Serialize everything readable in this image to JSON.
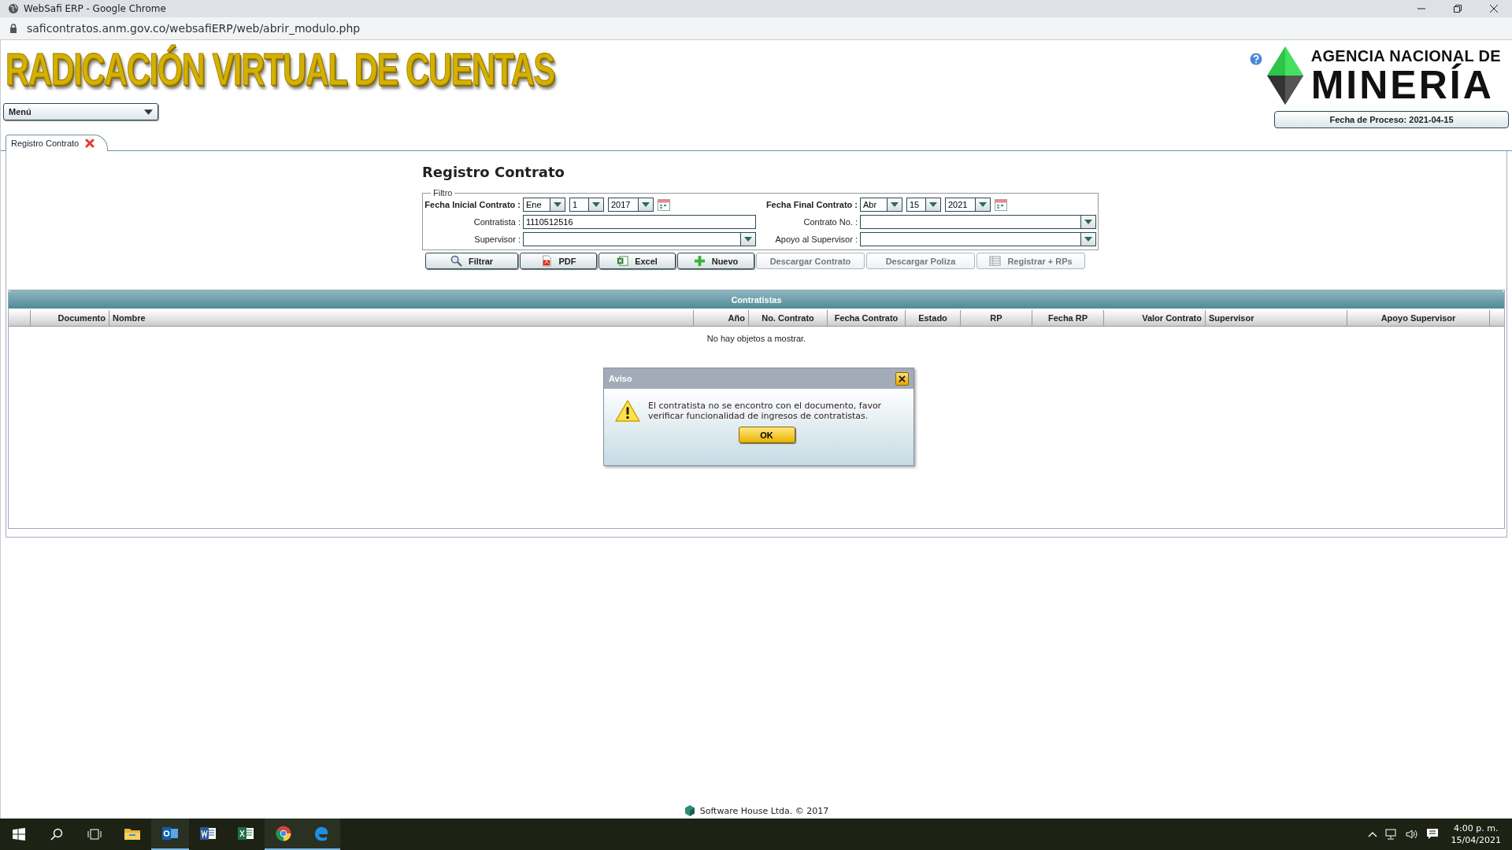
{
  "window": {
    "title": "WebSafi ERP - Google Chrome",
    "url": "saficontratos.anm.gov.co/websafiERP/web/abrir_modulo.php"
  },
  "banner": {
    "title": "RADICACIÓN VIRTUAL DE CUENTAS",
    "agency_line1": "AGENCIA NACIONAL DE",
    "agency_line2": "MINERÍA",
    "process_date": "Fecha de Proceso: 2021-04-15"
  },
  "menu": {
    "label": "Menú"
  },
  "tabs": [
    {
      "label": "Registro Contrato",
      "selected": true
    }
  ],
  "form": {
    "title": "Registro Contrato",
    "legend": "Filtro",
    "fecha_inicial": {
      "label": "Fecha Inicial Contrato :",
      "month": "Ene",
      "day": "1",
      "year": "2017"
    },
    "fecha_final": {
      "label": "Fecha Final Contrato :",
      "month": "Abr",
      "day": "15",
      "year": "2021"
    },
    "contratista": {
      "label": "Contratista :",
      "value": "1110512516"
    },
    "contrato_no": {
      "label": "Contrato No. :"
    },
    "supervisor": {
      "label": "Supervisor :"
    },
    "apoyo": {
      "label": "Apoyo al Supervisor :"
    },
    "buttons": [
      {
        "label": "Filtrar",
        "kind": "search",
        "disabled": false
      },
      {
        "label": "PDF",
        "kind": "pdf",
        "disabled": false
      },
      {
        "label": "Excel",
        "kind": "excel",
        "disabled": false
      },
      {
        "label": "Nuevo",
        "kind": "add",
        "disabled": false
      },
      {
        "label": "Descargar Contrato",
        "kind": "plain",
        "disabled": true
      },
      {
        "label": "Descargar Poliza",
        "kind": "plain",
        "disabled": true
      },
      {
        "label": "Registrar + RPs",
        "kind": "grid",
        "disabled": true
      }
    ]
  },
  "table": {
    "title": "Contratistas",
    "columns": [
      "Documento",
      "Nombre",
      "Año",
      "No. Contrato",
      "Fecha Contrato",
      "Estado",
      "RP",
      "Fecha RP",
      "Valor Contrato",
      "Supervisor",
      "Apoyo Supervisor"
    ],
    "empty_message": "No hay objetos a mostrar."
  },
  "dialog": {
    "title": "Aviso",
    "message": "El contratista no se encontro con el documento, favor verificar funcionalidad de ingresos de contratistas.",
    "button": "OK"
  },
  "footer": "Software House Ltda. © 2017",
  "taskbar": {
    "apps": [
      {
        "kind": "explorer",
        "active": false
      },
      {
        "kind": "outlook",
        "active": true
      },
      {
        "kind": "word",
        "active": false
      },
      {
        "kind": "excel",
        "active": false
      },
      {
        "kind": "chrome",
        "active": true
      },
      {
        "kind": "edge",
        "active": true
      }
    ],
    "time": "4:00 p. m.",
    "date": "15/04/2021"
  }
}
